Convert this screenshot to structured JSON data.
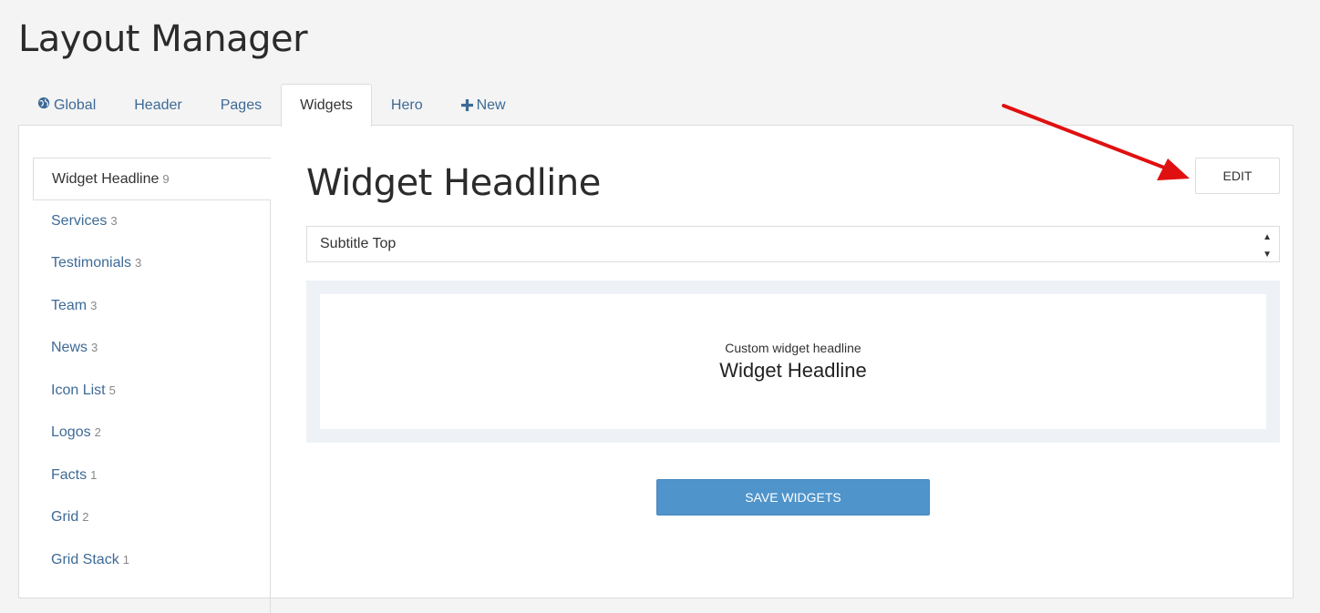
{
  "page": {
    "title": "Layout Manager"
  },
  "tabs": [
    {
      "label": "Global",
      "icon": "globe-icon"
    },
    {
      "label": "Header"
    },
    {
      "label": "Pages"
    },
    {
      "label": "Widgets",
      "active": true
    },
    {
      "label": "Hero"
    },
    {
      "label": "New",
      "icon": "plus-icon"
    }
  ],
  "sidebar": {
    "items": [
      {
        "label": "Widget Headline",
        "count": "9",
        "active": true
      },
      {
        "label": "Services",
        "count": "3"
      },
      {
        "label": "Testimonials",
        "count": "3"
      },
      {
        "label": "Team",
        "count": "3"
      },
      {
        "label": "News",
        "count": "3"
      },
      {
        "label": "Icon List",
        "count": "5"
      },
      {
        "label": "Logos",
        "count": "2"
      },
      {
        "label": "Facts",
        "count": "1"
      },
      {
        "label": "Grid",
        "count": "2"
      },
      {
        "label": "Grid Stack",
        "count": "1"
      }
    ]
  },
  "main": {
    "title": "Widget Headline",
    "edit_label": "EDIT",
    "layout_select": {
      "value": "Subtitle Top"
    },
    "preview": {
      "subtitle": "Custom widget headline",
      "headline": "Widget Headline"
    },
    "save_label": "SAVE WIDGETS"
  },
  "colors": {
    "link": "#3d6a96",
    "save_button": "#4f94cb",
    "annotation_arrow": "#e01010"
  }
}
